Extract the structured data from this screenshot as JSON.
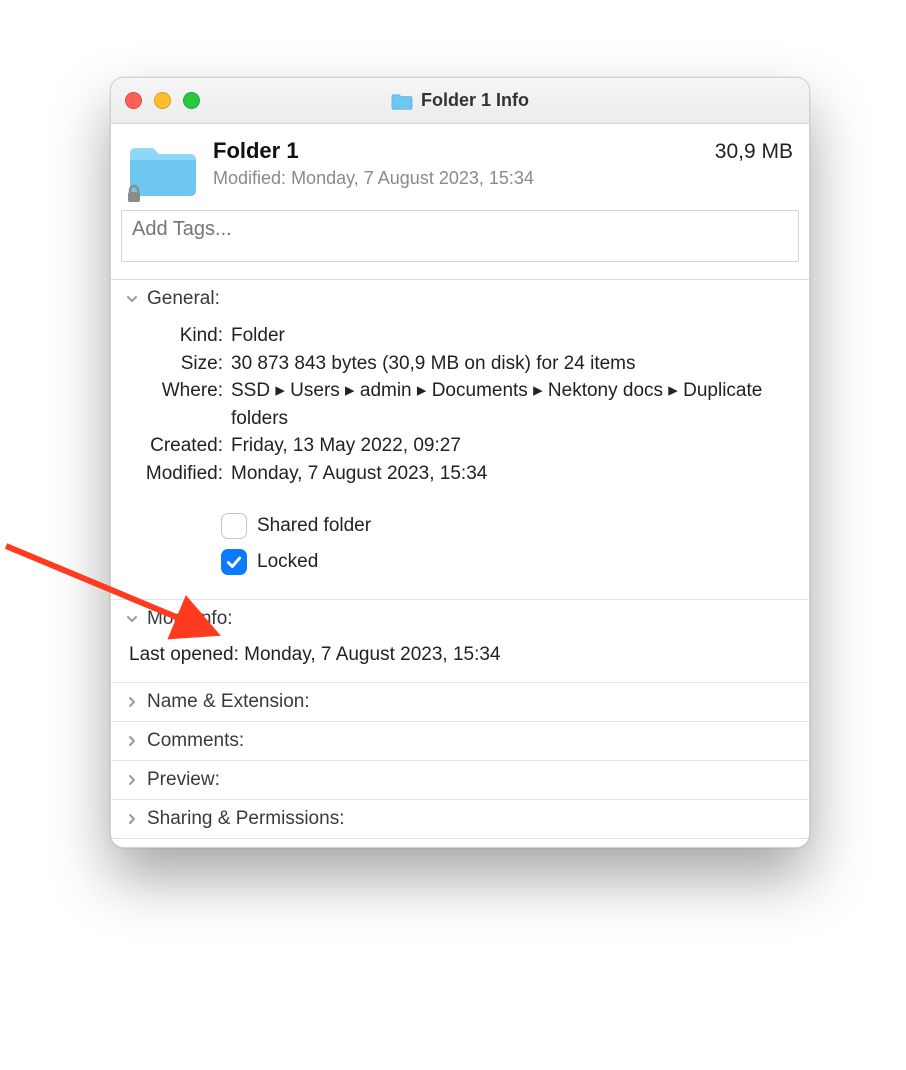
{
  "window_title": "Folder 1 Info",
  "header": {
    "name": "Folder 1",
    "modified_label": "Modified:",
    "modified_value": "Monday, 7 August 2023, 15:34",
    "size": "30,9 MB"
  },
  "tags_placeholder": "Add Tags...",
  "sections": {
    "general": {
      "title": "General:",
      "kind_label": "Kind:",
      "kind_value": "Folder",
      "size_label": "Size:",
      "size_value": "30 873 843 bytes (30,9 MB on disk) for 24 items",
      "where_label": "Where:",
      "where_value": "SSD ▸ Users ▸ admin ▸ Documents ▸ Nektony docs ▸ Duplicate folders",
      "created_label": "Created:",
      "created_value": "Friday, 13 May 2022, 09:27",
      "modified_label": "Modified:",
      "modified_value": "Monday, 7 August 2023, 15:34",
      "shared_label": "Shared folder",
      "shared_checked": false,
      "locked_label": "Locked",
      "locked_checked": true
    },
    "more_info": {
      "title": "More Info:",
      "last_opened_label": "Last opened:",
      "last_opened_value": "Monday, 7 August 2023, 15:34"
    },
    "name_ext": {
      "title": "Name & Extension:"
    },
    "comments": {
      "title": "Comments:"
    },
    "preview": {
      "title": "Preview:"
    },
    "sharing": {
      "title": "Sharing & Permissions:"
    }
  }
}
